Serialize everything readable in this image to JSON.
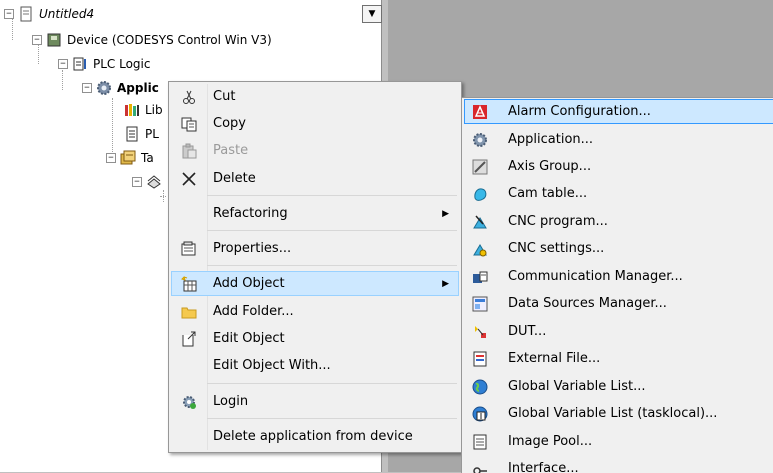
{
  "tree": {
    "project": "Untitled4",
    "device": "Device (CODESYS Control Win V3)",
    "plc_logic": "PLC Logic",
    "application": "Applic",
    "library": "Lib",
    "plc_prg": "PL",
    "task_config": "Ta"
  },
  "context_menu": {
    "items": [
      {
        "label": "Cut",
        "icon": "scissors-icon"
      },
      {
        "label": "Copy",
        "icon": "copy-icon"
      },
      {
        "label": "Paste",
        "icon": "paste-icon",
        "disabled": true
      },
      {
        "label": "Delete",
        "icon": "delete-x-icon"
      },
      {
        "label": "Refactoring",
        "submenu": true
      },
      {
        "label": "Properties...",
        "icon": "properties-icon"
      },
      {
        "label": "Add Object",
        "icon": "add-object-icon",
        "submenu": true,
        "highlighted": true
      },
      {
        "label": "Add Folder...",
        "icon": "folder-icon"
      },
      {
        "label": "Edit Object",
        "icon": "edit-object-icon"
      },
      {
        "label": "Edit Object With..."
      },
      {
        "label": "Login",
        "icon": "login-icon"
      },
      {
        "label": "Delete application from device"
      }
    ]
  },
  "submenu": {
    "items": [
      {
        "label": "Alarm Configuration...",
        "icon": "alarm-icon",
        "highlighted": true
      },
      {
        "label": "Application...",
        "icon": "gear-icon"
      },
      {
        "label": "Axis Group...",
        "icon": "axis-group-icon"
      },
      {
        "label": "Cam table...",
        "icon": "cam-table-icon"
      },
      {
        "label": "CNC program...",
        "icon": "cnc-program-icon"
      },
      {
        "label": "CNC settings...",
        "icon": "cnc-settings-icon"
      },
      {
        "label": "Communication Manager...",
        "icon": "communication-icon"
      },
      {
        "label": "Data Sources Manager...",
        "icon": "data-sources-icon"
      },
      {
        "label": "DUT...",
        "icon": "dut-icon"
      },
      {
        "label": "External File...",
        "icon": "external-file-icon"
      },
      {
        "label": "Global Variable List...",
        "icon": "globe-icon"
      },
      {
        "label": "Global Variable List (tasklocal)...",
        "icon": "globe-task-icon"
      },
      {
        "label": "Image Pool...",
        "icon": "image-pool-icon"
      },
      {
        "label": "Interface...",
        "icon": "interface-icon"
      }
    ]
  },
  "colors": {
    "highlight": "#cde8ff",
    "highlight_border": "#3399ff",
    "menu_bg": "#f0f0f0"
  }
}
